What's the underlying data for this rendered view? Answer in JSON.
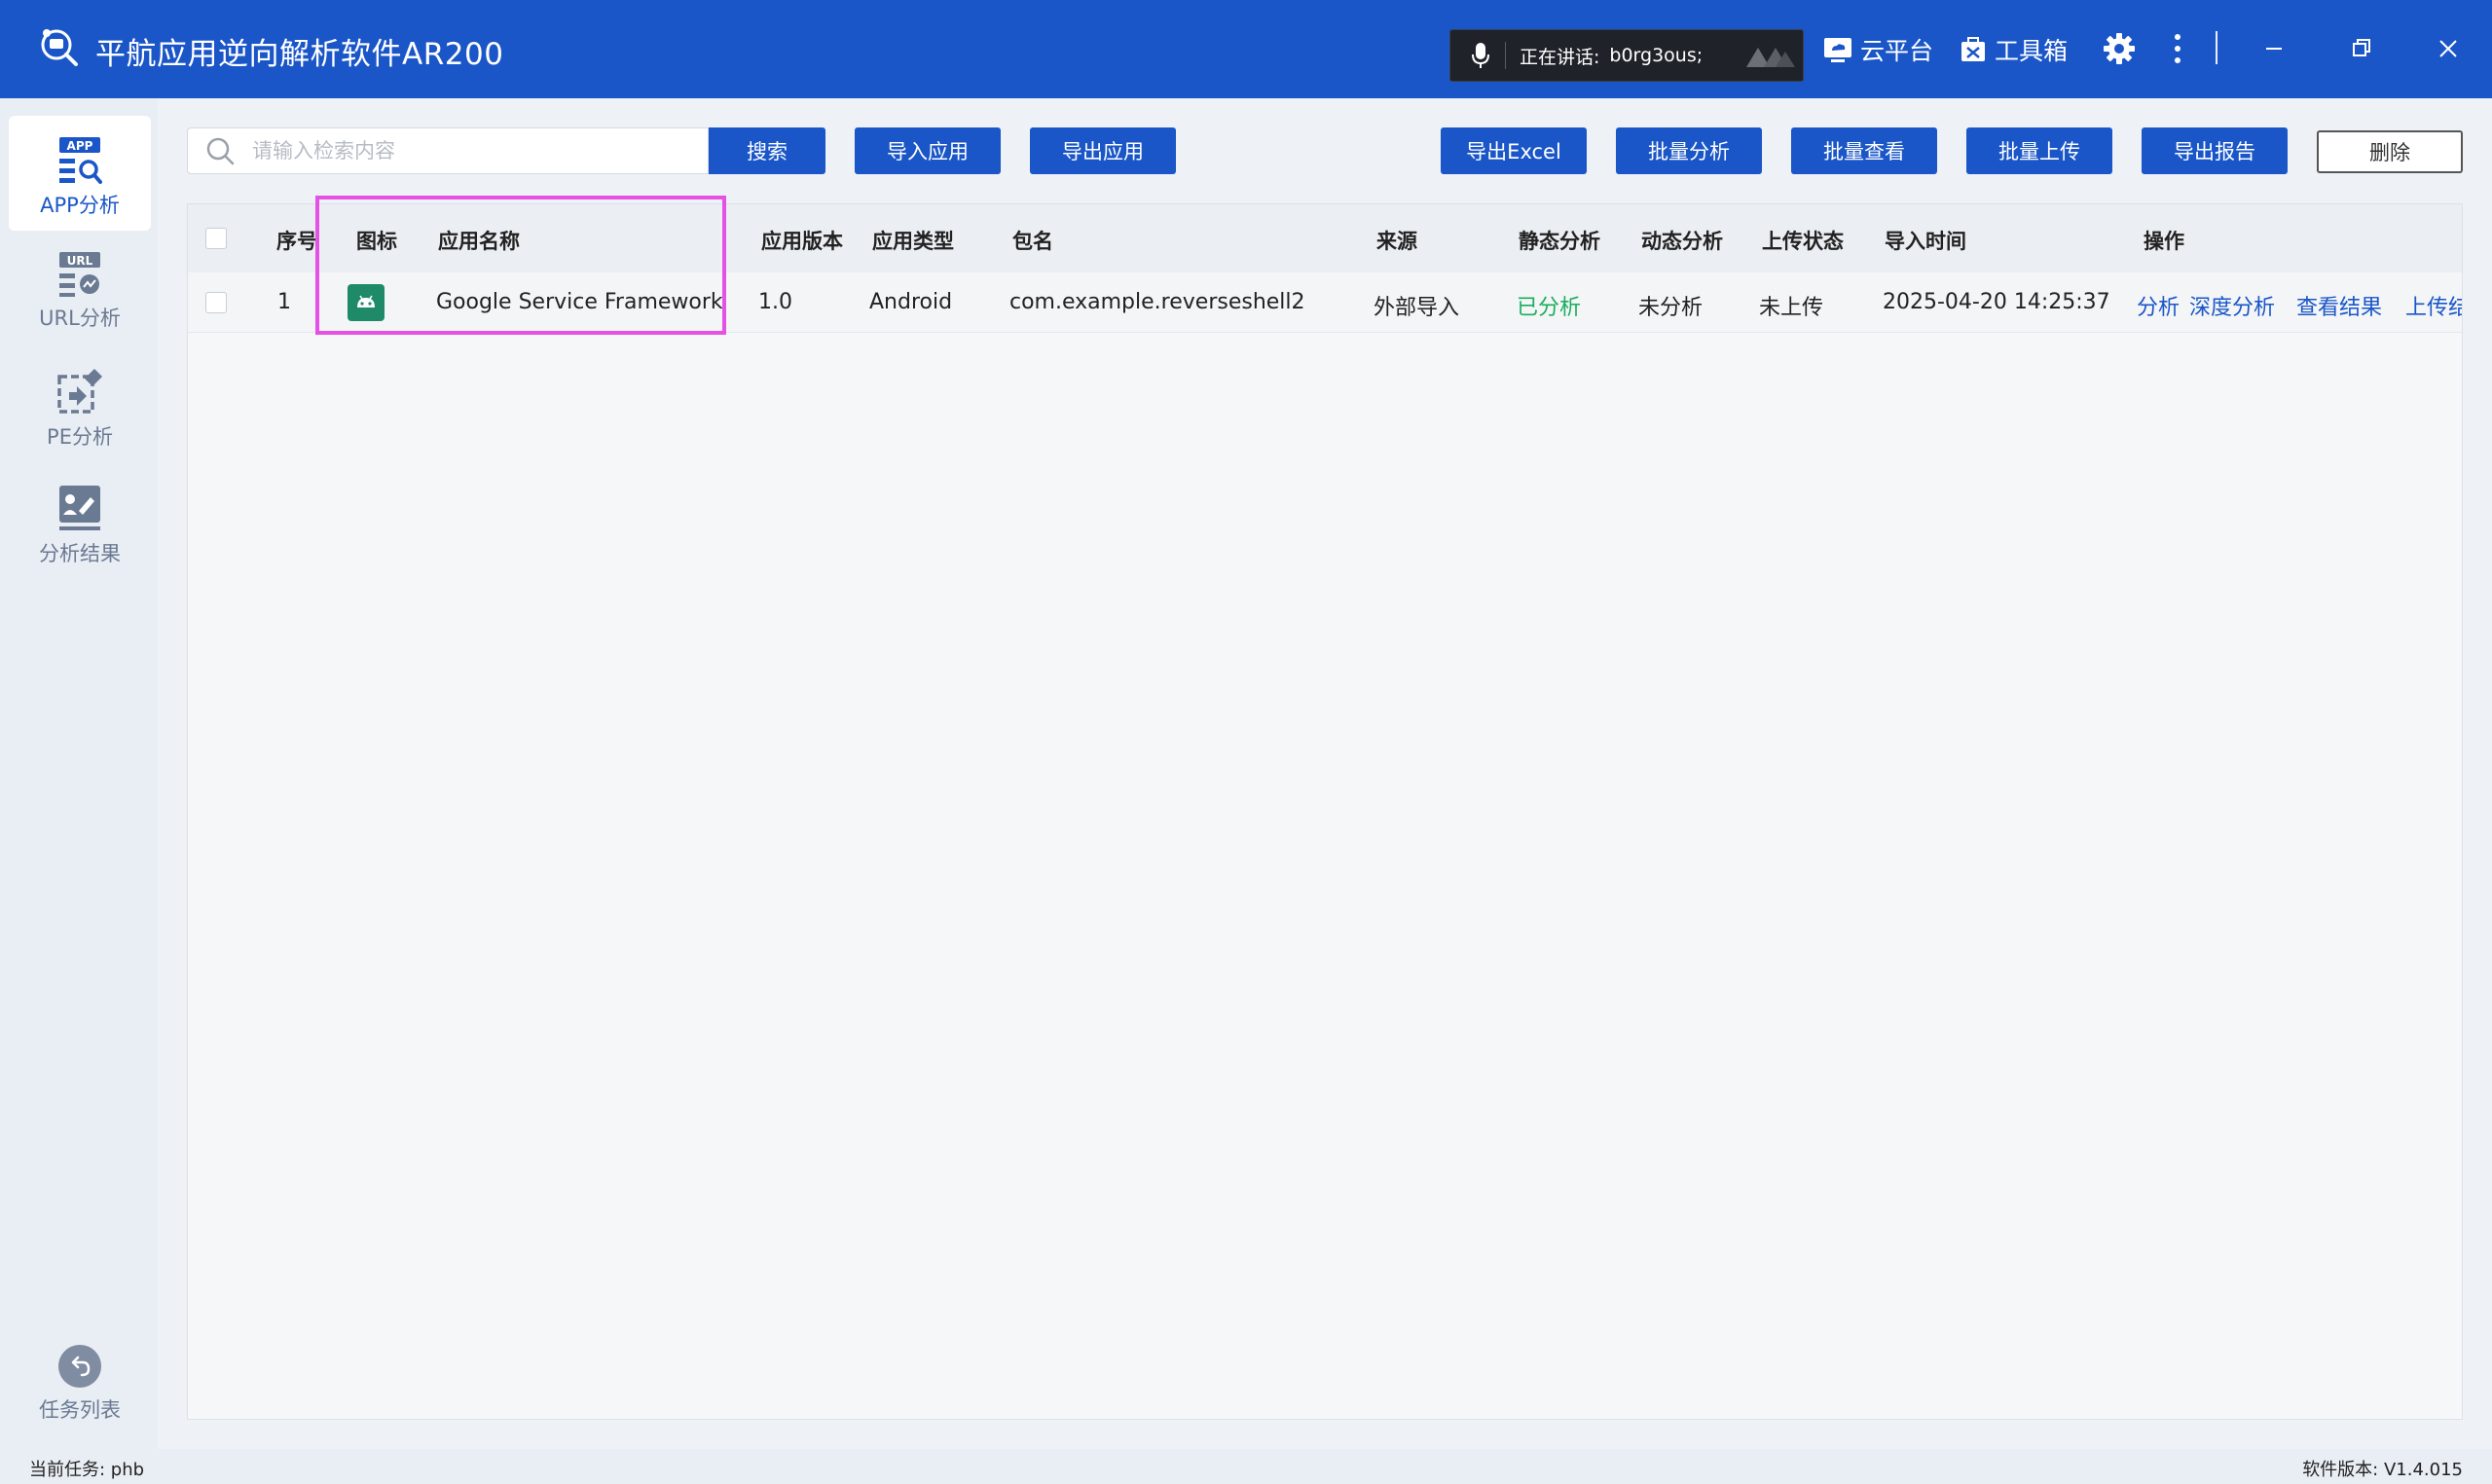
{
  "window": {
    "title": "平航应用逆向解析软件AR200",
    "speaking_label": "正在讲话:",
    "speaking_user": "b0rg3ous;",
    "cloud_label": "云平台",
    "toolbox_label": "工具箱"
  },
  "sidebar": {
    "items": [
      {
        "label": "APP分析",
        "icon": "app-analysis-icon",
        "active": true
      },
      {
        "label": "URL分析",
        "icon": "url-analysis-icon",
        "active": false
      },
      {
        "label": "PE分析",
        "icon": "pe-analysis-icon",
        "active": false
      },
      {
        "label": "分析结果",
        "icon": "analysis-result-icon",
        "active": false
      }
    ],
    "task_list_label": "任务列表"
  },
  "toolbar": {
    "search_placeholder": "请输入检索内容",
    "search_label": "搜索",
    "import_label": "导入应用",
    "export_label": "导出应用",
    "export_excel_label": "导出Excel",
    "batch_analyze_label": "批量分析",
    "batch_view_label": "批量查看",
    "batch_upload_label": "批量上传",
    "export_report_label": "导出报告",
    "delete_label": "删除"
  },
  "table": {
    "headers": [
      "序号",
      "图标",
      "应用名称",
      "应用版本",
      "应用类型",
      "包名",
      "来源",
      "静态分析",
      "动态分析",
      "上传状态",
      "导入时间",
      "操作"
    ],
    "rows": [
      {
        "index": "1",
        "name": "Google Service Framework",
        "version": "1.0",
        "type": "Android",
        "package": "com.example.reverseshell2",
        "source": "外部导入",
        "static": "已分析",
        "dynamic": "未分析",
        "upload": "未上传",
        "time": "2025-04-20 14:25:37",
        "actions": [
          "分析",
          "深度分析",
          "查看结果",
          "上传结"
        ]
      }
    ]
  },
  "status": {
    "current_task": "当前任务: phb",
    "version": "软件版本: V1.4.015"
  },
  "colors": {
    "primary": "#1a56c8",
    "success": "#1aae5c",
    "highlight": "#e551e5"
  }
}
